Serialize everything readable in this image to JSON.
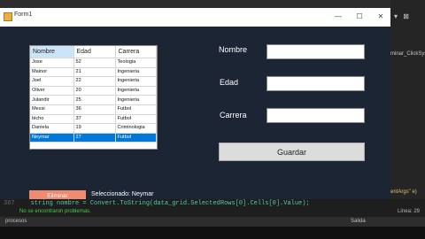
{
  "window": {
    "title": "Form1"
  },
  "grid": {
    "columns": [
      "Nombre",
      "Edad",
      "Carrera"
    ],
    "rows": [
      {
        "nombre": "Jose",
        "edad": "52",
        "carrera": "Teologia"
      },
      {
        "nombre": "Mainor",
        "edad": "21",
        "carrera": "Ingenieria"
      },
      {
        "nombre": "Joel",
        "edad": "22",
        "carrera": "Ingenieria"
      },
      {
        "nombre": "Oliver",
        "edad": "20",
        "carrera": "Ingenieria"
      },
      {
        "nombre": "Julandir",
        "edad": "25",
        "carrera": "Ingenieria"
      },
      {
        "nombre": "Messi",
        "edad": "36",
        "carrera": "Futbol"
      },
      {
        "nombre": "bicho",
        "edad": "37",
        "carrera": "Futbol"
      },
      {
        "nombre": "Daniela",
        "edad": "19",
        "carrera": "Criminologia"
      },
      {
        "nombre": "Neymar",
        "edad": "27",
        "carrera": "Futbol"
      }
    ],
    "selected_row": "Neymar"
  },
  "buttons": {
    "eliminar": "Eliminar",
    "guardar": "Guardar"
  },
  "selection_label": "Seleccionado: Neymar",
  "form": {
    "nombre_label": "Nombre",
    "edad_label": "Edad",
    "carrera_label": "Carrera",
    "nombre_value": "",
    "edad_value": "",
    "carrera_value": ""
  },
  "ide": {
    "side_text": "minar_ClickSys",
    "side_bottom": "entArgs\" e)",
    "code_line_no": "367",
    "code_text": "string nombre = Convert.ToString(data_grid.SelectedRows[0].Cells[0].Value);",
    "status_ok": "No se encontraron problemas.",
    "status_right": "Línea: 29",
    "output_label": "procesos",
    "output_mid": "Salida"
  },
  "colors": {
    "form_bg": "#1b2533",
    "eliminar_bg": "#f08a70",
    "selection_bg": "#0078d7"
  }
}
